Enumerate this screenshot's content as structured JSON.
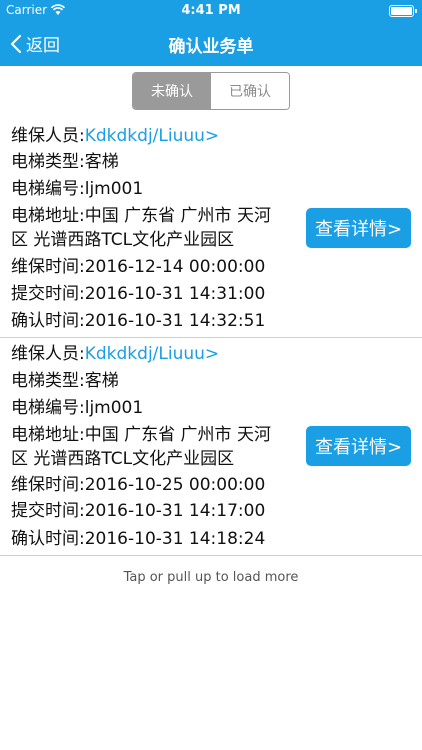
{
  "status_bar": {
    "carrier": "Carrier",
    "time": "4:41 PM"
  },
  "nav": {
    "back_label": "返回",
    "title": "确认业务单"
  },
  "segment": {
    "unconfirmed": "未确认",
    "confirmed": "已确认",
    "selected": "未确认"
  },
  "records": [
    {
      "staff_label": "维保人员:",
      "staff_value": "Kdkdkdj/Liuuu>",
      "type": "电梯类型:客梯",
      "number": "电梯编号:ljm001",
      "address_line1": "电梯地址:中国 广东省 广州市 天河",
      "address_line2": "区 光谱西路TCL文化产业园区",
      "maintenance_time": "维保时间:2016-12-14 00:00:00",
      "submit_time": "提交时间:2016-10-31 14:31:00",
      "confirm_time": "确认时间:2016-10-31 14:32:51",
      "detail_button": "查看详情>"
    },
    {
      "staff_label": "维保人员:",
      "staff_value": "Kdkdkdj/Liuuu>",
      "type": "电梯类型:客梯",
      "number": "电梯编号:ljm001",
      "address_line1": "电梯地址:中国 广东省 广州市 天河",
      "address_line2": "区 光谱西路TCL文化产业园区",
      "maintenance_time": "维保时间:2016-10-25 00:00:00",
      "submit_time": "提交时间:2016-10-31 14:17:00",
      "confirm_time": "确认时间:2016-10-31 14:18:24",
      "detail_button": "查看详情>"
    }
  ],
  "load_more": "Tap or pull up to load more",
  "colors": {
    "accent": "#1a9ee4",
    "segment_active": "#9a9a9a",
    "separator": "#cfcfcf"
  }
}
